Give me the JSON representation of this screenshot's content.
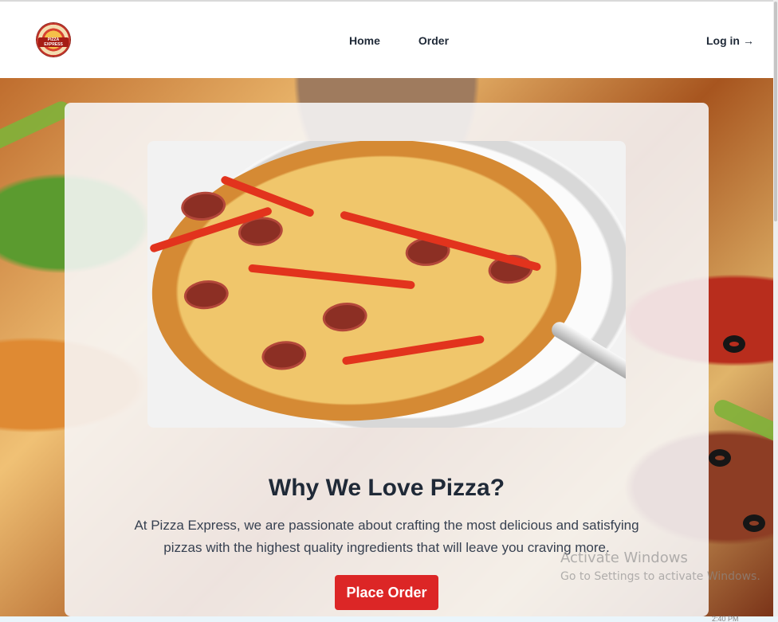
{
  "navbar": {
    "logo_text": "PIZZA EXPRESS",
    "links": [
      {
        "label": "Home"
      },
      {
        "label": "Order"
      }
    ],
    "login_label": "Log in",
    "login_arrow": "→"
  },
  "hero": {
    "heading": "Why We Love Pizza?",
    "description": "At Pizza Express, we are passionate about crafting the most delicious and satisfying pizzas with the highest quality ingredients that will leave you craving more.",
    "button_label": "Place Order"
  },
  "watermark": {
    "title": "Activate Windows",
    "subtitle": "Go to Settings to activate Windows."
  },
  "bottom_text": "2:40 PM",
  "colors": {
    "accent": "#dc2626",
    "text": "#1f2937",
    "navbar_bg": "#ffffff"
  },
  "icons": [
    "pizza-logo-icon",
    "arrow-right-icon"
  ]
}
